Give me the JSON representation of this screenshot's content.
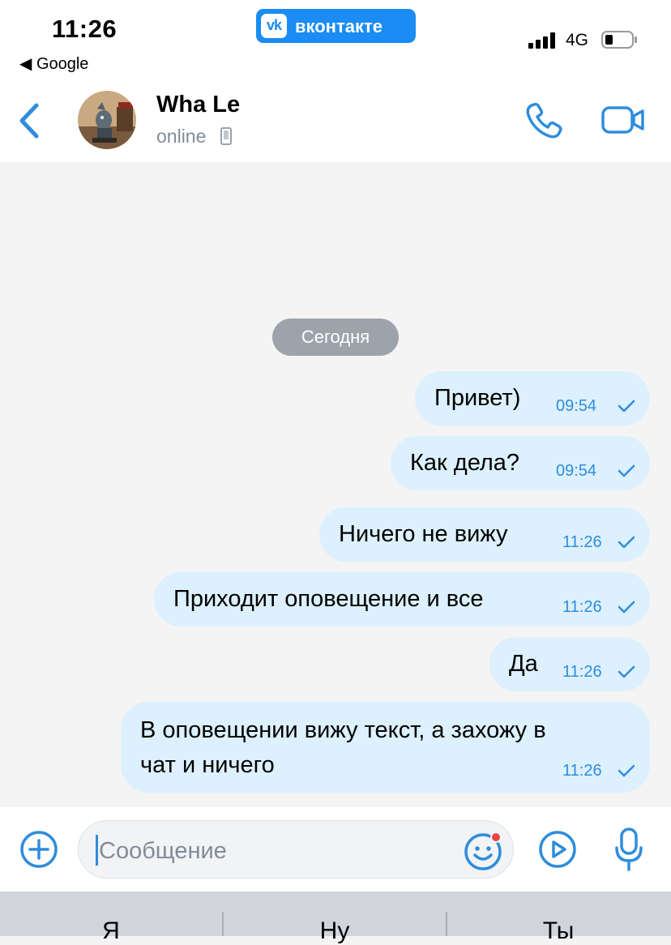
{
  "status_bar": {
    "time": "11:26",
    "back_app": "◀ Google",
    "app_badge": "вконтакте",
    "vk_logo": "vk",
    "network": "4G"
  },
  "header": {
    "contact_name": "Wha Le",
    "contact_status": "online"
  },
  "chat": {
    "date_divider": "Сегодня",
    "messages": [
      {
        "text": "Привет)",
        "time": "09:54",
        "outgoing": true,
        "read": true
      },
      {
        "text": "Как дела?",
        "time": "09:54",
        "outgoing": true,
        "read": true
      },
      {
        "text": "Ничего не вижу",
        "time": "11:26",
        "outgoing": true,
        "read": true
      },
      {
        "text": "Приходит оповещение и все",
        "time": "11:26",
        "outgoing": true,
        "read": true
      },
      {
        "text": "Да",
        "time": "11:26",
        "outgoing": true,
        "read": true
      },
      {
        "text": "В оповещении вижу текст, а захожу в",
        "text_line2": "чат и ничего",
        "time": "11:26",
        "outgoing": true,
        "read": true
      }
    ]
  },
  "composer": {
    "placeholder": "Сообщение",
    "value": ""
  },
  "keyboard": {
    "suggestions": [
      "Я",
      "Ну",
      "Ты"
    ]
  },
  "colors": {
    "accent": "#2f8ddb",
    "vk_blue": "#1a8cf3",
    "bubble_out": "#dcf0fd",
    "chat_bg": "#f4f4f4",
    "date_pill": "#9da3aa",
    "notification_dot": "#e64646"
  },
  "icons": {
    "back": "chevron-left-icon",
    "call": "phone-icon",
    "video": "video-camera-icon",
    "attach": "plus-circle-icon",
    "emoji": "smiley-icon",
    "video_message": "play-circle-icon",
    "voice": "microphone-icon",
    "read_receipt": "check-icon"
  }
}
